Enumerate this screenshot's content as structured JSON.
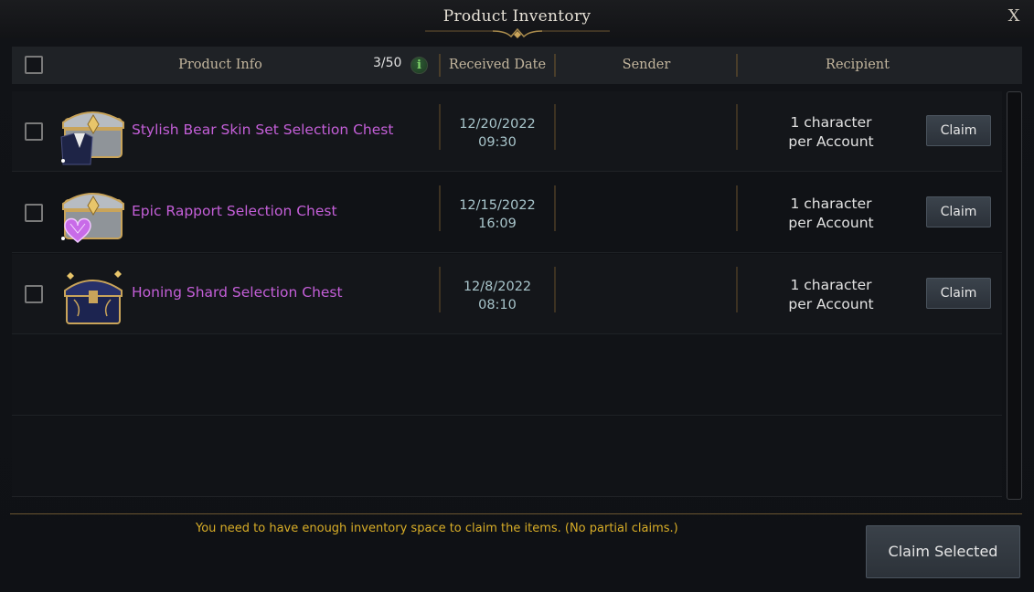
{
  "window": {
    "title": "Product Inventory",
    "close_label": "X"
  },
  "header": {
    "product_info": "Product Info",
    "count": "3/50",
    "info_icon": "i",
    "received_date": "Received Date",
    "sender": "Sender",
    "recipient": "Recipient"
  },
  "items": [
    {
      "name": "Stylish Bear Skin Set Selection Chest",
      "date": "12/20/2022",
      "time": "09:30",
      "recipient_line1": "1 character",
      "recipient_line2": "per Account",
      "claim_label": "Claim",
      "icon": "silver-chest-suit-icon"
    },
    {
      "name": "Epic Rapport Selection Chest",
      "date": "12/15/2022",
      "time": "16:09",
      "recipient_line1": "1 character",
      "recipient_line2": "per Account",
      "claim_label": "Claim",
      "icon": "silver-chest-heart-gem-icon"
    },
    {
      "name": "Honing Shard Selection Chest",
      "date": "12/8/2022",
      "time": "08:10",
      "recipient_line1": "1 character",
      "recipient_line2": "per Account",
      "claim_label": "Claim",
      "icon": "dark-blue-chest-icon"
    }
  ],
  "footer": {
    "notice": "You need to have enough inventory space to claim the items. (No partial claims.)",
    "claim_selected_label": "Claim Selected"
  },
  "colors": {
    "item_name": "#c45fd8",
    "date": "#a9c6cc",
    "notice": "#d8ad27",
    "header_text": "#c2b59d"
  }
}
